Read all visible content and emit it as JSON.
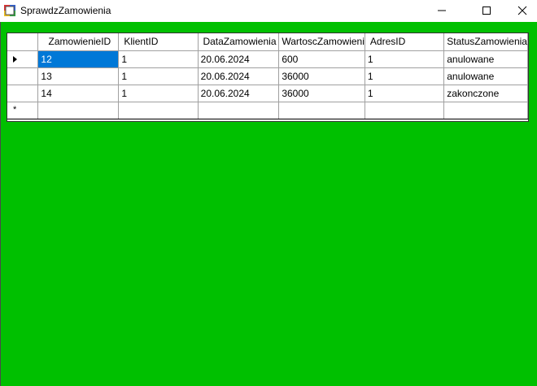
{
  "window": {
    "title": "SprawdzZamowienia",
    "icon": "form-icon"
  },
  "grid": {
    "columns": [
      "ZamowienieID",
      "KlientID",
      "DataZamowienia",
      "WartoscZamowieni",
      "AdresID",
      "StatusZamowienia"
    ],
    "rows": [
      [
        "12",
        "1",
        "20.06.2024",
        "600",
        "1",
        "anulowane"
      ],
      [
        "13",
        "1",
        "20.06.2024",
        "36000",
        "1",
        "anulowane"
      ],
      [
        "14",
        "1",
        "20.06.2024",
        "36000",
        "1",
        "zakonczone"
      ]
    ],
    "new_row_marker": "*",
    "current_row_icon": "row-pointer-icon",
    "selection_color": "#0078d7"
  },
  "colors": {
    "background": "#00c000"
  }
}
